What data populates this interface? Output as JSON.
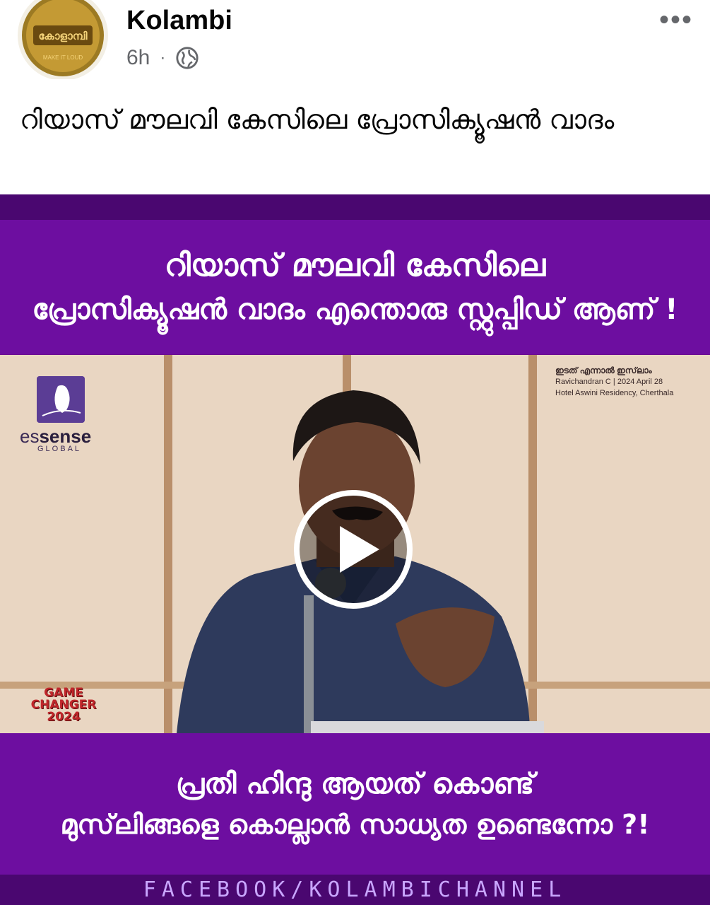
{
  "post": {
    "page_name": "Kolambi",
    "time": "6h",
    "dot": "·",
    "more": "•••",
    "caption": "റിയാസ് മൗലവി കേസിലെ പ്രോസിക്യൂഷൻ വാദം",
    "avatar": {
      "logo_text": "കോളാമ്പി",
      "tagline": "MAKE IT LOUD"
    }
  },
  "media": {
    "title_line1": "റിയാസ് മൗലവി കേസിലെ",
    "title_line2": "പ്രോസിക്യൂഷൻ വാദം എന്തൊരു സ്റ്റുപ്പിഡ് ആണ് !",
    "bottom_line1": "പ്രതി ഹിന്ദു ആയത് കൊണ്ട്",
    "bottom_line2": "മുസ്‌ലിങ്ങളെ കൊല്ലാൻ സാധ്യത ഉണ്ടെന്നോ ?!",
    "footer": "FACEBOOK/KOLAMBICHANNEL",
    "video": {
      "brand_es": "es",
      "brand_sense": "sense",
      "brand_sub": "GLOBAL",
      "event_title": "ഇടത് എന്നാൽ ഇസ്‌ലാം",
      "event_line1": "Ravichandran C | 2024 April 28",
      "event_line2": "Hotel Aswini Residency, Cherthala",
      "gc_line1": "GAME",
      "gc_line2": "CHANGER",
      "gc_line3": "2024"
    }
  },
  "colors": {
    "accent_purple": "#6d0ea0",
    "dark_purple": "#4a0770"
  }
}
